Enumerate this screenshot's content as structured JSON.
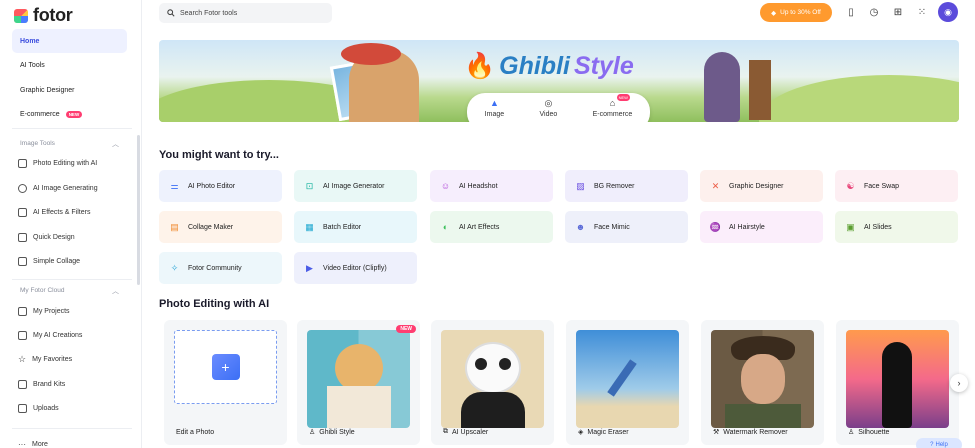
{
  "app": {
    "logo_text": "fotor"
  },
  "sidebar": {
    "primary": [
      {
        "label": "Home",
        "active": true
      },
      {
        "label": "AI Tools"
      },
      {
        "label": "Graphic Designer"
      },
      {
        "label": "E-commerce",
        "badge": "NEW"
      }
    ],
    "image_tools_label": "Image Tools",
    "image_tools": [
      {
        "label": "Photo Editing with AI",
        "icon": "photo-edit-icon"
      },
      {
        "label": "AI Image Generating",
        "icon": "sparkle-icon"
      },
      {
        "label": "AI Effects & Filters",
        "icon": "magic-wand-icon"
      },
      {
        "label": "Quick Design",
        "icon": "design-icon"
      },
      {
        "label": "Simple Collage",
        "icon": "collage-icon"
      }
    ],
    "cloud_label": "My Fotor Cloud",
    "cloud": [
      {
        "label": "My Projects",
        "icon": "projects-icon"
      },
      {
        "label": "My AI Creations",
        "icon": "ai-creations-icon"
      },
      {
        "label": "My Favorites",
        "icon": "star-icon"
      },
      {
        "label": "Brand Kits",
        "icon": "brand-icon"
      },
      {
        "label": "Uploads",
        "icon": "upload-icon"
      }
    ],
    "more_label": "More"
  },
  "header": {
    "search_placeholder": "Search Fotor tools",
    "promo": "Up to 30% Off"
  },
  "banner": {
    "title_word1": "Ghibli",
    "title_word2": "Style",
    "tabs": [
      {
        "label": "Image",
        "active": true
      },
      {
        "label": "Video"
      },
      {
        "label": "E-commerce",
        "badge": "NEW"
      }
    ]
  },
  "try_section": {
    "title": "You might want to try...",
    "tools": [
      {
        "label": "AI Photo Editor",
        "bg": "#eef2fd",
        "color": "#3b6ff5"
      },
      {
        "label": "AI Image Generator",
        "bg": "#e9f8f6",
        "color": "#19b3a0"
      },
      {
        "label": "AI Headshot",
        "bg": "#f6eefd",
        "color": "#b048d8"
      },
      {
        "label": "BG Remover",
        "bg": "#f0eefc",
        "color": "#6a4fe0"
      },
      {
        "label": "Graphic Designer",
        "bg": "#fdf0ed",
        "color": "#ec5a44"
      },
      {
        "label": "Face Swap",
        "bg": "#fdeff3",
        "color": "#e8467a"
      },
      {
        "label": "Collage Maker",
        "bg": "#fef3ea",
        "color": "#f08a2e"
      },
      {
        "label": "Batch Editor",
        "bg": "#e8f7fb",
        "color": "#1fa8d0"
      },
      {
        "label": "AI Art Effects",
        "bg": "#ecf8ee",
        "color": "#3bbf5a"
      },
      {
        "label": "Face Mimic",
        "bg": "#eef0fa",
        "color": "#5d6cd8"
      },
      {
        "label": "AI Hairstyle",
        "bg": "#fbeefb",
        "color": "#c447c9"
      },
      {
        "label": "AI Slides",
        "bg": "#f0f8ea",
        "color": "#5a9e2f"
      },
      {
        "label": "Fotor Community",
        "bg": "#edf7fb",
        "color": "#2aa5d6"
      },
      {
        "label": "Video Editor (Clipfly)",
        "bg": "#eef0fc",
        "color": "#4b5ce6"
      }
    ]
  },
  "photo_section": {
    "title": "Photo Editing with AI",
    "cards": [
      {
        "label": "Edit a Photo"
      },
      {
        "label": "Ghibli Style",
        "badge": "NEW"
      },
      {
        "label": "AI Upscaler"
      },
      {
        "label": "Magic Eraser"
      },
      {
        "label": "Watermark Remover"
      },
      {
        "label": "Silhouette"
      }
    ]
  },
  "help_label": "Help"
}
